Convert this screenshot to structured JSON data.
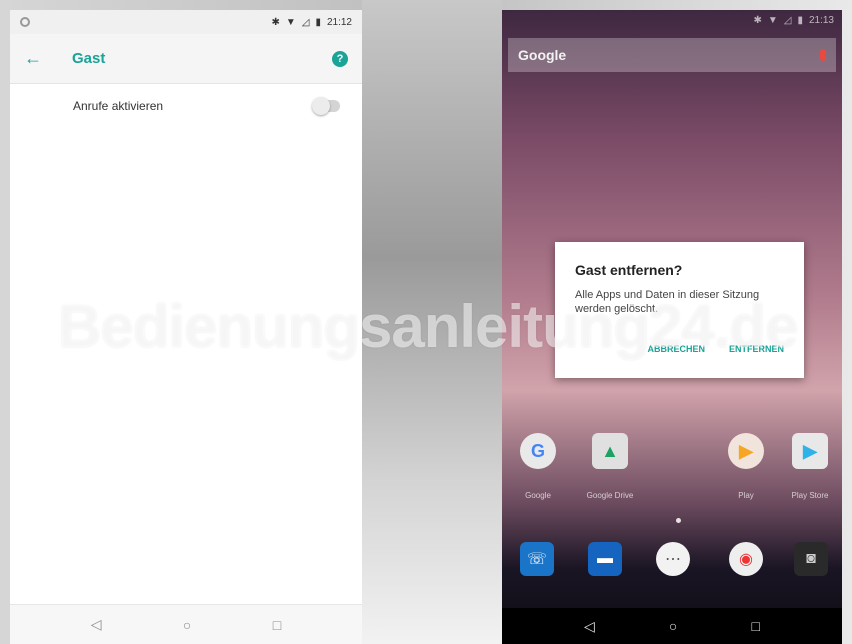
{
  "left_phone": {
    "status_bar": {
      "time": "21:12"
    },
    "app_bar": {
      "back_icon": "arrow-left-icon",
      "title": "Gast",
      "help_icon": "help-icon"
    },
    "settings": [
      {
        "label": "Anrufe aktivieren",
        "toggle_on": false
      }
    ],
    "nav_bar": {
      "back": "◁",
      "home": "○",
      "recents": "□"
    }
  },
  "right_phone": {
    "status_bar": {
      "time": "21:13"
    },
    "search": {
      "logo": "Google",
      "mic_icon": "mic-icon"
    },
    "dialog": {
      "title": "Gast entfernen?",
      "message": "Alle Apps und Daten in dieser Sitzung werden gelöscht.",
      "cancel_label": "ABBRECHEN",
      "confirm_label": "ENTFERNEN"
    },
    "apps": [
      {
        "label": "Google",
        "icon": "google-icon"
      },
      {
        "label": "Google Drive",
        "icon": "drive-icon"
      },
      {
        "label": "Play",
        "icon": "play-icon"
      },
      {
        "label": "Play Store",
        "icon": "play-store-icon"
      }
    ],
    "dock": [
      {
        "icon": "phone-icon"
      },
      {
        "icon": "messages-icon"
      },
      {
        "icon": "app-drawer-icon"
      },
      {
        "icon": "chrome-icon"
      },
      {
        "icon": "camera-icon"
      }
    ],
    "nav_bar": {
      "back": "◁",
      "home": "○",
      "recents": "□"
    }
  },
  "watermark": "Bedienungsanleitung24.de",
  "colors": {
    "accent": "#1aa397",
    "dialog_bg": "#ffffff",
    "nav_dark": "#000000"
  }
}
